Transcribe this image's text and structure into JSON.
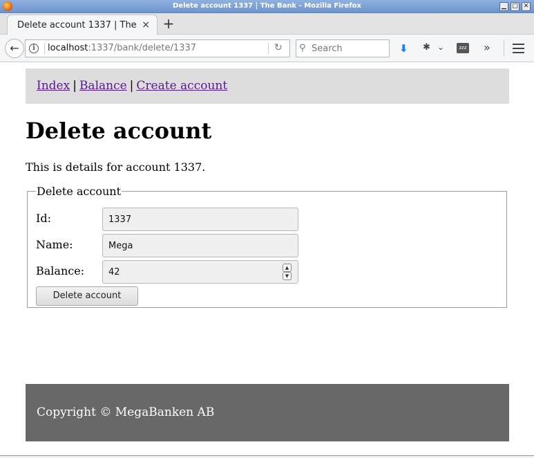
{
  "window": {
    "title": "Delete account 1337 | The Bank - Mozilla Firefox"
  },
  "browser": {
    "tab_title": "Delete account 1337 | The Bank",
    "tab_close": "×",
    "new_tab": "+",
    "url_host": "localhost",
    "url_rest": ":1337/bank/delete/1337",
    "search_placeholder": "Search",
    "icons": {
      "back": "arrow-left-icon",
      "info": "info-icon",
      "reload": "reload-icon",
      "search": "search-icon",
      "download": "download-icon",
      "extension": "extension-icon",
      "zzz": "zzz-icon",
      "overflow": "overflow-icon",
      "menu": "menu-icon"
    },
    "zzz_label": "zzz"
  },
  "nav": {
    "links": [
      "Index",
      "Balance",
      "Create account"
    ],
    "separator": "|"
  },
  "main": {
    "title": "Delete account",
    "intro": "This is details for account 1337.",
    "form": {
      "legend": "Delete account",
      "fields": [
        {
          "label": "Id:",
          "value": "1337"
        },
        {
          "label": "Name:",
          "value": "Mega"
        },
        {
          "label": "Balance:",
          "value": "42"
        }
      ],
      "submit_label": "Delete account"
    }
  },
  "footer": {
    "text": "Copyright © MegaBanken AB"
  },
  "colors": {
    "link": "#551a8b",
    "nav_bg": "#dddddd",
    "footer_bg": "#686868",
    "download_accent": "#0a84ff"
  }
}
